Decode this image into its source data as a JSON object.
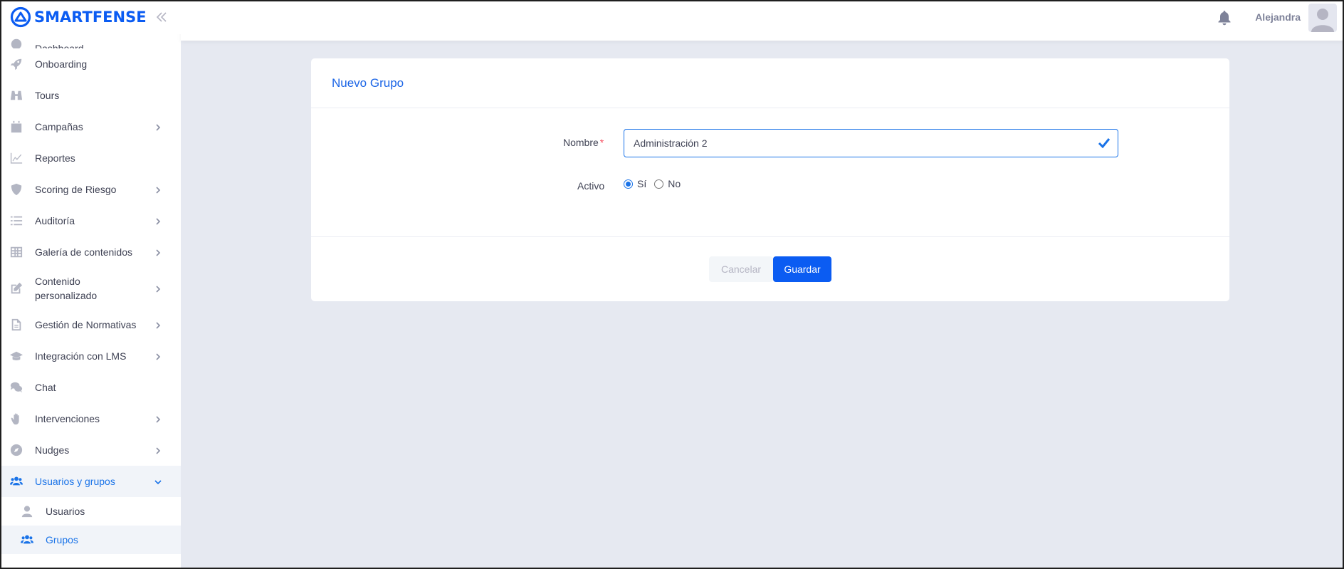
{
  "brand": {
    "name": "SMARTFENSE"
  },
  "sidebar": {
    "items": [
      {
        "label": "Dashboard",
        "icon": "dashboard-icon",
        "has_children": false
      },
      {
        "label": "Onboarding",
        "icon": "rocket-icon",
        "has_children": false
      },
      {
        "label": "Tours",
        "icon": "binoculars-icon",
        "has_children": false
      },
      {
        "label": "Campañas",
        "icon": "calendar-icon",
        "has_children": true
      },
      {
        "label": "Reportes",
        "icon": "chart-line-icon",
        "has_children": false
      },
      {
        "label": "Scoring de Riesgo",
        "icon": "shield-icon",
        "has_children": true
      },
      {
        "label": "Auditoría",
        "icon": "list-icon",
        "has_children": true
      },
      {
        "label": "Galería de contenidos",
        "icon": "grid-icon",
        "has_children": true
      },
      {
        "label": "Contenido personalizado",
        "icon": "edit-icon",
        "has_children": true
      },
      {
        "label": "Gestión de Normativas",
        "icon": "document-icon",
        "has_children": true
      },
      {
        "label": "Integración con LMS",
        "icon": "graduation-cap-icon",
        "has_children": true
      },
      {
        "label": "Chat",
        "icon": "chat-icon",
        "has_children": false
      },
      {
        "label": "Intervenciones",
        "icon": "hand-icon",
        "has_children": true
      },
      {
        "label": "Nudges",
        "icon": "compass-icon",
        "has_children": true
      },
      {
        "label": "Usuarios y grupos",
        "icon": "users-icon",
        "has_children": true,
        "expanded": true
      }
    ],
    "subitems": [
      {
        "label": "Usuarios",
        "icon": "user-icon"
      },
      {
        "label": "Grupos",
        "icon": "users-icon",
        "current": true
      }
    ]
  },
  "topbar": {
    "user_name": "Alejandra"
  },
  "form": {
    "title": "Nuevo Grupo",
    "nombre_label": "Nombre",
    "required_mark": "*",
    "nombre_value": "Administración 2",
    "activo_label": "Activo",
    "activo_options": [
      "Sí",
      "No"
    ],
    "activo_selected": "Sí",
    "cancel_label": "Cancelar",
    "save_label": "Guardar"
  },
  "colors": {
    "accent": "#0b5cf2",
    "link": "#1a73e8",
    "background": "#e6e9f1"
  }
}
